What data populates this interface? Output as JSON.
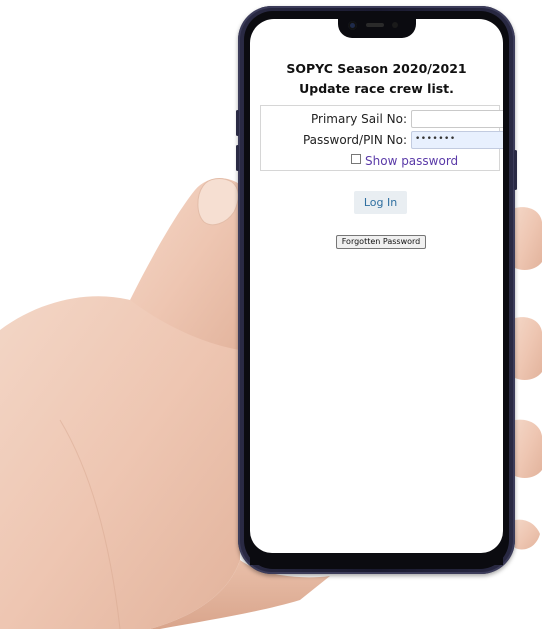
{
  "page": {
    "title_line1": "SOPYC Season 2020/2021",
    "title_line2": "Update race crew list."
  },
  "login_form": {
    "sail_label": "Primary Sail No:",
    "sail_value": "",
    "pin_label": "Password/PIN No:",
    "pin_masked": "•••••••",
    "show_password_label": "Show password",
    "show_password_checked": false
  },
  "actions": {
    "login_label": "Log In",
    "forgot_label": "Forgotten Password"
  },
  "colors": {
    "phone_frame": "#1a1a30",
    "link_purple": "#5a3aa8",
    "login_text": "#2f6fa0",
    "autofill_bg": "#e8f0fe"
  }
}
